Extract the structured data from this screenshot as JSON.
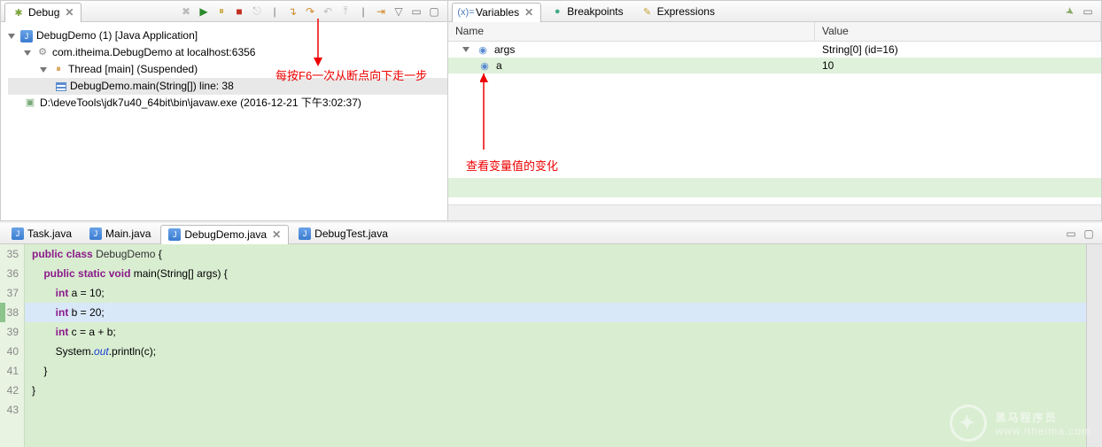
{
  "debug": {
    "tab_label": "Debug",
    "tree": {
      "root": "DebugDemo (1) [Java Application]",
      "conn": "com.itheima.DebugDemo at localhost:6356",
      "thread": "Thread [main] (Suspended)",
      "frame": "DebugDemo.main(String[]) line: 38",
      "proc": "D:\\deveTools\\jdk7u40_64bit\\bin\\javaw.exe (2016-12-21 下午3:02:37)"
    }
  },
  "vars": {
    "tab_variables": "Variables",
    "tab_breakpoints": "Breakpoints",
    "tab_expressions": "Expressions",
    "col_name": "Name",
    "col_value": "Value",
    "rows": [
      {
        "name": "args",
        "value": "String[0]  (id=16)"
      },
      {
        "name": "a",
        "value": "10"
      }
    ]
  },
  "anno1": "每按F6一次从断点向下走一步",
  "anno2": "查看变量值的变化",
  "editor": {
    "tabs": {
      "task": "Task.java",
      "main": "Main.java",
      "demo": "DebugDemo.java",
      "test": "DebugTest.java"
    },
    "lines": [
      {
        "n": "35",
        "html": "<span class='kw'>public</span> <span class='kw'>class</span> <span class='cls'>DebugDemo</span> {"
      },
      {
        "n": "36",
        "html": "    <span class='kw'>public</span> <span class='kw'>static</span> <span class='kw'>void</span> main(String[] args) {"
      },
      {
        "n": "37",
        "html": "        <span class='typ'>int</span> a = 10;"
      },
      {
        "n": "38",
        "html": "        <span class='typ'>int</span> b = 20;",
        "cur": true
      },
      {
        "n": "39",
        "html": "        <span class='typ'>int</span> c = a + b;"
      },
      {
        "n": "40",
        "html": "        System.<span class='fld'>out</span>.println(c);"
      },
      {
        "n": "41",
        "html": "    }"
      },
      {
        "n": "42",
        "html": "}"
      },
      {
        "n": "43",
        "html": ""
      }
    ]
  },
  "brand": {
    "name": "黑马程序员",
    "url": "www.itheima.com"
  }
}
